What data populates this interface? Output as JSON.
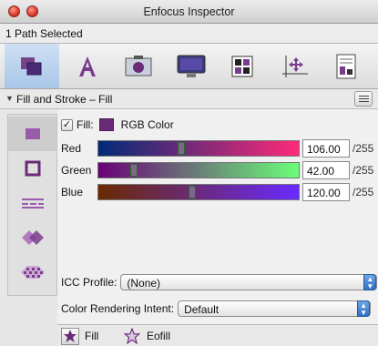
{
  "window": {
    "title": "Enfocus Inspector"
  },
  "selection_info": "1 Path Selected",
  "toolbar": {
    "tabs": [
      {
        "icon": "path-object-icon",
        "active": true
      },
      {
        "icon": "text-icon",
        "active": false
      },
      {
        "icon": "image-icon",
        "active": false
      },
      {
        "icon": "monitor-icon",
        "active": false
      },
      {
        "icon": "layout-icon",
        "active": false
      },
      {
        "icon": "position-axes-icon",
        "active": false
      },
      {
        "icon": "document-properties-icon",
        "active": false
      }
    ]
  },
  "panel": {
    "title": "Fill and Stroke – Fill"
  },
  "left_tools": [
    {
      "icon": "fill-square-icon",
      "active": true
    },
    {
      "icon": "stroke-square-icon",
      "active": false
    },
    {
      "icon": "dash-lines-icon",
      "active": false
    },
    {
      "icon": "diamond-overlap-icon",
      "active": false
    },
    {
      "icon": "pattern-fill-icon",
      "active": false
    }
  ],
  "fill": {
    "label": "Fill:",
    "checked": true,
    "color_mode": "RGB Color",
    "swatch_color": "#6a2a78"
  },
  "sliders": [
    {
      "name": "Red",
      "value": "106.00",
      "max": "/255",
      "position": 0.4157
    },
    {
      "name": "Green",
      "value": "42.00",
      "max": "/255",
      "position": 0.1647
    },
    {
      "name": "Blue",
      "value": "120.00",
      "max": "/255",
      "position": 0.4706
    }
  ],
  "icc_profile": {
    "label": "ICC Profile:",
    "value": "(None)"
  },
  "rendering_intent": {
    "label": "Color Rendering Intent:",
    "value": "Default"
  },
  "fill_rule": {
    "fill_label": "Fill",
    "eofill_label": "Eofill"
  },
  "colors": {
    "accent": "#2f6fc7",
    "active_tab": "#a9c6e8",
    "fill_color": "#6a2a78"
  }
}
